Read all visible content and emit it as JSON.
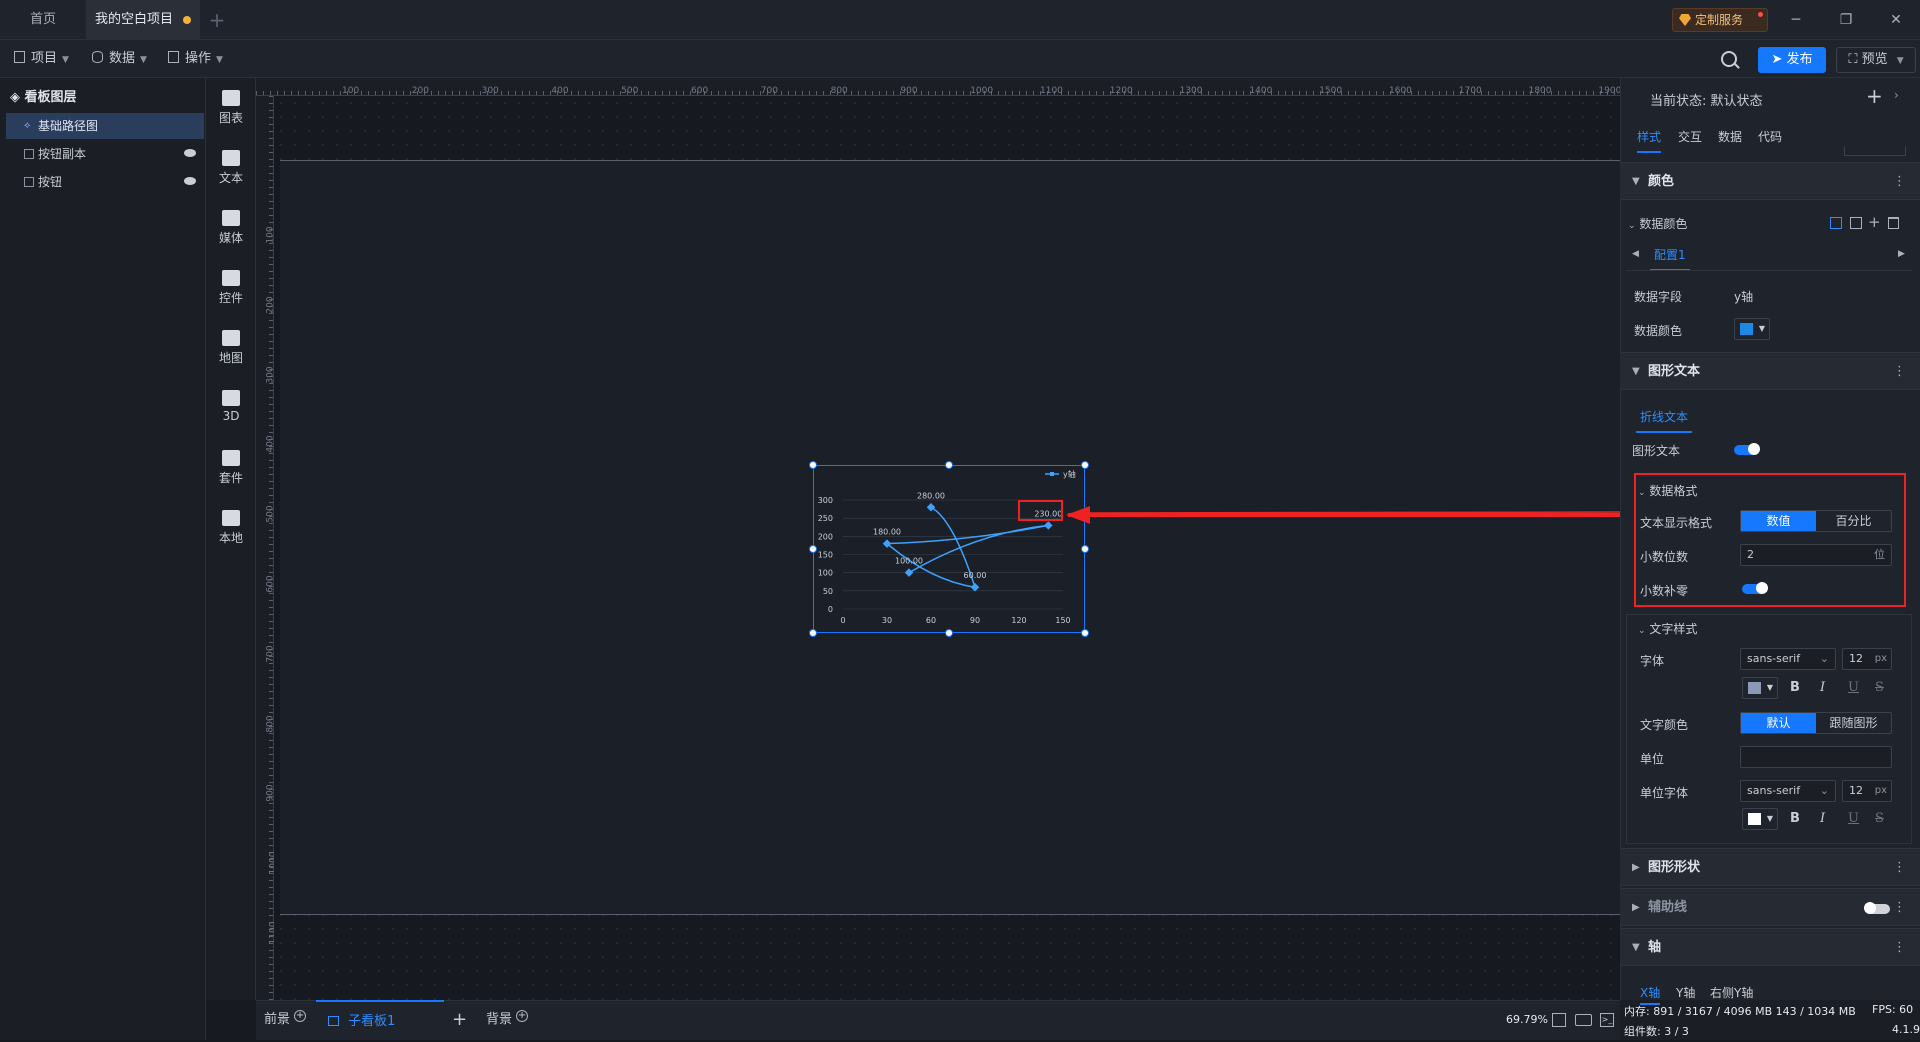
{
  "titlebar": {
    "tabs": [
      {
        "label": "首页"
      },
      {
        "label": "我的空白项目"
      }
    ],
    "custom_service": "定制服务"
  },
  "toolbar": {
    "project": "项目",
    "data": "数据",
    "operation": "操作",
    "publish": "发布",
    "preview": "预览"
  },
  "layers": {
    "title": "看板图层",
    "items": [
      {
        "label": "基础路径图"
      },
      {
        "label": "按钮副本"
      },
      {
        "label": "按钮"
      }
    ]
  },
  "components": [
    "图表",
    "文本",
    "媒体",
    "控件",
    "地图",
    "3D",
    "套件",
    "本地"
  ],
  "ruler": {
    "h": [
      "100",
      "200",
      "300",
      "400",
      "500",
      "600",
      "700",
      "800",
      "900",
      "1000",
      "1100",
      "1200",
      "1300",
      "1400",
      "1500",
      "1600",
      "1700",
      "1800",
      "1900"
    ],
    "v": [
      "100",
      "200",
      "300",
      "400",
      "500",
      "600",
      "700",
      "800",
      "900",
      "1000",
      "1100"
    ]
  },
  "chart_data": {
    "type": "line",
    "legend": "y轴",
    "legend_position": "top-right",
    "x": [
      60,
      90,
      30,
      140,
      45
    ],
    "y": [
      280,
      60,
      180,
      230,
      100
    ],
    "labels": [
      "280.00",
      "60.00",
      "180.00",
      "230.00",
      "100.00"
    ],
    "xticks": [
      "0",
      "30",
      "60",
      "90",
      "120",
      "150"
    ],
    "yticks": [
      "0",
      "50",
      "100",
      "150",
      "200",
      "250",
      "300"
    ],
    "xlim": [
      0,
      150
    ],
    "ylim": [
      0,
      300
    ],
    "grid": true,
    "color": "#3da2ff"
  },
  "bottombar": {
    "foreground": "前景",
    "subboard": "子看板1",
    "background": "背景",
    "zoom": "69.79%"
  },
  "status": {
    "memory": "内存: 891 / 3167 / 4096 MB  143 / 1034 MB",
    "fps": "FPS: 60",
    "components": "组件数: 3 / 3",
    "version": "4.1.9"
  },
  "panel": {
    "state_label": "当前状态:",
    "state_value": "默认状态",
    "tabs": [
      "样式",
      "交互",
      "数据",
      "代码"
    ],
    "color_section": "颜色",
    "data_color": "数据颜色",
    "config": "配置1",
    "data_field_label": "数据字段",
    "data_field_value": "y轴",
    "data_color_label": "数据颜色",
    "shape_text_section": "图形文本",
    "polyline_text_tab": "折线文本",
    "shape_text_label": "图形文本",
    "data_format": "数据格式",
    "text_display_format": "文本显示格式",
    "fmt_value": "数值",
    "fmt_percent": "百分比",
    "decimals_label": "小数位数",
    "decimals_value": "2",
    "decimals_unit": "位",
    "zero_pad_label": "小数补零",
    "text_style": "文字样式",
    "font_label": "字体",
    "font_value": "sans-serif",
    "font_size": "12",
    "px": "px",
    "text_color_label": "文字颜色",
    "text_color_default": "默认",
    "text_color_follow": "跟随图形",
    "unit_label": "单位",
    "unit_font_label": "单位字体",
    "shape_section": "图形形状",
    "guide_section": "辅助线",
    "axis_section": "轴",
    "axis_tabs": [
      "X轴",
      "Y轴",
      "右侧Y轴"
    ]
  },
  "colors": {
    "accent": "#1677ff",
    "annotation": "#e22222",
    "line": "#3da2ff",
    "data_swatch": "#1e88e5",
    "font_swatch": "#8c9ab8",
    "unit_swatch": "#ffffff"
  }
}
